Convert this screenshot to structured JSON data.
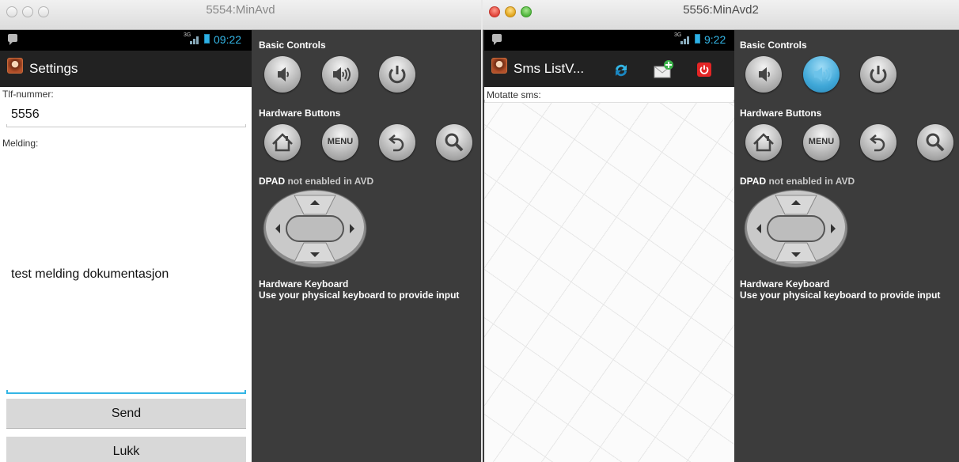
{
  "window1": {
    "title": "5554:MinAvd",
    "status": {
      "network": "3G",
      "time": "09:22"
    },
    "app": {
      "title": "Settings"
    },
    "form": {
      "phone_label": "Tlf-nummer:",
      "phone_value": "5556",
      "message_label": "Melding:",
      "message_value": "test melding dokumentasjon",
      "send_label": "Send",
      "close_label": "Lukk"
    }
  },
  "window2": {
    "title": "5556:MinAvd2",
    "status": {
      "network": "3G",
      "time": "9:22"
    },
    "app": {
      "title": "Sms ListV..."
    },
    "received_label": "Motatte sms:",
    "actions": [
      "refresh-icon",
      "compose-sms-icon",
      "power-icon"
    ]
  },
  "controls": {
    "basic_controls": "Basic Controls",
    "hardware_buttons": "Hardware Buttons",
    "dpad_prefix": "DPAD",
    "dpad_note": "not enabled in AVD",
    "keyboard_heading": "Hardware Keyboard",
    "keyboard_note": "Use your physical keyboard to provide input",
    "menu_label": "MENU",
    "basic_buttons": [
      "volume-down-icon",
      "volume-up-icon",
      "power-icon"
    ],
    "hardware_button_icons": [
      "home-icon",
      "menu-button",
      "back-icon",
      "search-icon"
    ]
  },
  "colors": {
    "holo_blue": "#33b5e5",
    "panel": "#3c3c3c",
    "action_bar": "#222222"
  }
}
